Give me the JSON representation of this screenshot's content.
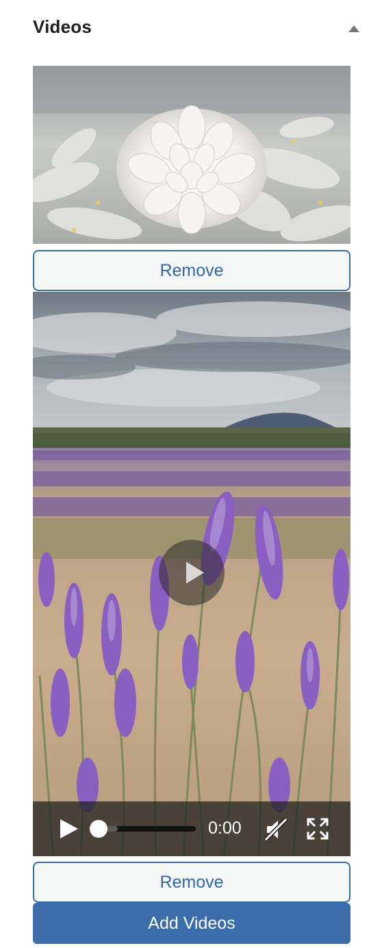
{
  "panel": {
    "title": "Videos"
  },
  "videos": [
    {
      "thumbnail": "white chrysanthemum flowers",
      "remove_label": "Remove"
    },
    {
      "thumbnail": "lavender field under cloudy sky",
      "remove_label": "Remove",
      "player": {
        "time": "0:00",
        "progress": 0,
        "buffered": 0.2,
        "muted": true
      }
    }
  ],
  "actions": {
    "add_label": "Add Videos"
  },
  "icons": {
    "collapse": "triangle-up-icon",
    "play_overlay": "play-circle-icon",
    "play": "play-icon",
    "mute": "speaker-muted-icon",
    "fullscreen": "fullscreen-icon"
  },
  "colors": {
    "accent": "#3a6da9",
    "remove_text": "#2f69aa",
    "remove_border": "#3a6ba6",
    "remove_bg": "#f5f6f6",
    "title_text": "#1e1e1e",
    "lavender": "#8a5fc2"
  }
}
